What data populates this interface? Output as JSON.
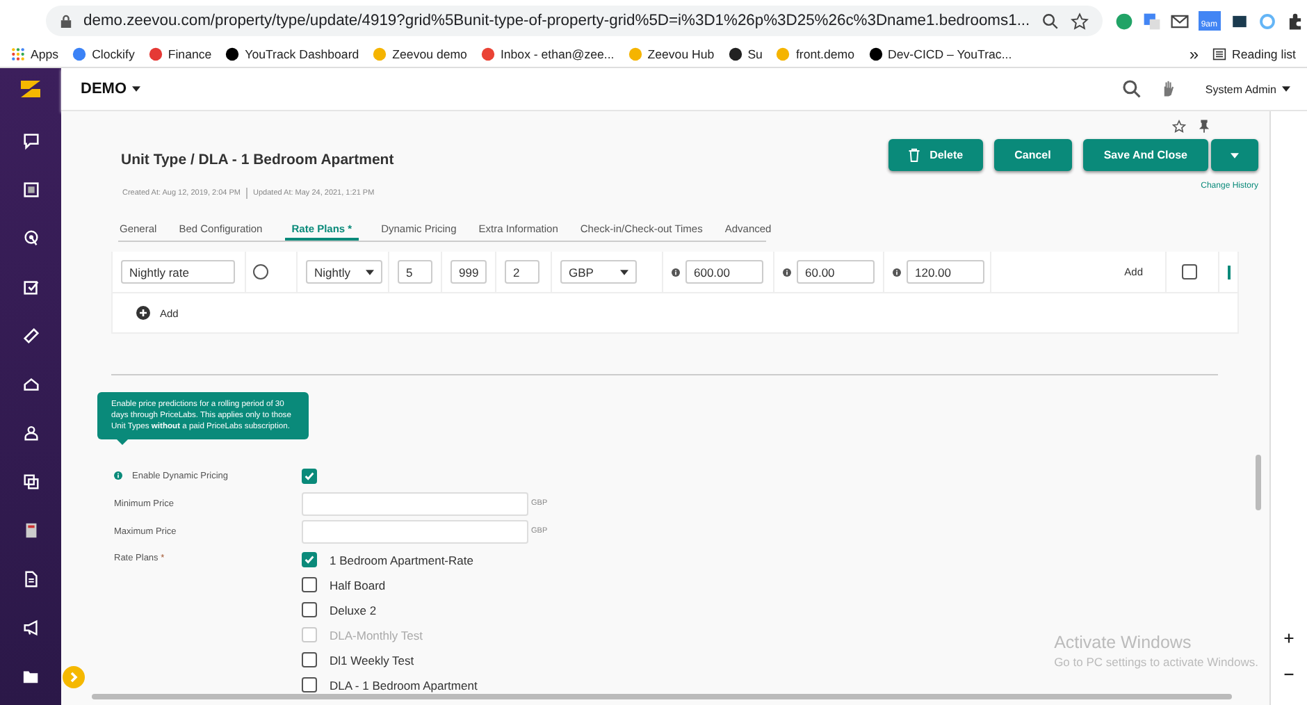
{
  "browser": {
    "url": "demo.zeevou.com/property/type/update/4919?grid%5Bunit-type-of-property-grid%5D=i%3D1%26p%3D25%26c%3Dname1.bedrooms1...",
    "extension_badge": "9am",
    "bookmarks": [
      "Apps",
      "Clockify",
      "Finance",
      "YouTrack Dashboard",
      "Zeevou demo",
      "Inbox - ethan@zee...",
      "Zeevou Hub",
      "Su",
      "front.demo",
      "Dev-CICD – YouTrac..."
    ],
    "more": "»",
    "reading_list": "Reading list"
  },
  "header": {
    "brand": "DEMO",
    "user": "System Admin"
  },
  "page": {
    "title": "Unit Type / DLA - 1 Bedroom Apartment",
    "created": "Created At: Aug 12, 2019, 2:04 PM",
    "updated": "Updated At: May 24, 2021, 1:21 PM",
    "buttons": [
      {
        "label": "Delete",
        "kind": "delete"
      },
      {
        "label": "Cancel",
        "kind": "plain"
      },
      {
        "label": "Save And Close",
        "kind": "plain"
      },
      {
        "kind": "caret"
      }
    ],
    "change_history": "Change History",
    "tabs": [
      {
        "label": "General",
        "selected": false
      },
      {
        "label": "Bed Configuration",
        "selected": false
      },
      {
        "label": "Rate Plans *",
        "selected": true
      },
      {
        "label": "Dynamic Pricing",
        "selected": false
      },
      {
        "label": "Extra Information",
        "selected": false
      },
      {
        "label": "Check-in/Check-out Times",
        "selected": false
      },
      {
        "label": "Advanced",
        "selected": false
      }
    ],
    "rate_row": [
      {
        "kind": "input",
        "value": "Nightly rate"
      },
      {
        "kind": "radio",
        "selected": false
      },
      {
        "kind": "select",
        "value": "Nightly"
      },
      {
        "kind": "input",
        "value": "5"
      },
      {
        "kind": "input",
        "value": "999"
      },
      {
        "kind": "input",
        "value": "2"
      },
      {
        "kind": "select",
        "value": "GBP"
      },
      {
        "kind": "info-input",
        "value": "600.00"
      },
      {
        "kind": "info-input",
        "value": "60.00"
      },
      {
        "kind": "info-input",
        "value": "120.00"
      },
      {
        "kind": "action",
        "label": "Add"
      },
      {
        "kind": "checkbox",
        "checked": false
      },
      {
        "kind": "cut"
      }
    ],
    "add_label": "Add",
    "tooltip": "Enable price predictions for a rolling period of 30 days through PriceLabs. This applies only to those Unit Types **without** a paid PriceLabs subscription.",
    "dynamic_pricing": {
      "label": "Enable Dynamic Pricing",
      "checked": true
    },
    "min_price": {
      "label": "Minimum Price",
      "currency": "GBP"
    },
    "max_price": {
      "label": "Maximum Price",
      "currency": "GBP"
    },
    "rate_plans": {
      "label": "Rate Plans",
      "required": "*",
      "items": [
        {
          "label": "1 Bedroom Apartment-Rate",
          "checked": true,
          "disabled": false
        },
        {
          "label": "Half Board",
          "checked": false,
          "disabled": false
        },
        {
          "label": "Deluxe 2",
          "checked": false,
          "disabled": false
        },
        {
          "label": "DLA-Monthly Test",
          "checked": false,
          "disabled": true
        },
        {
          "label": "Dl1 Weekly Test",
          "checked": false,
          "disabled": false
        },
        {
          "label": "DLA - 1 Bedroom Apartment",
          "checked": false,
          "disabled": false
        }
      ]
    }
  },
  "windows_notice": {
    "title": "Activate Windows",
    "text": "Go to PC settings to activate Windows."
  }
}
